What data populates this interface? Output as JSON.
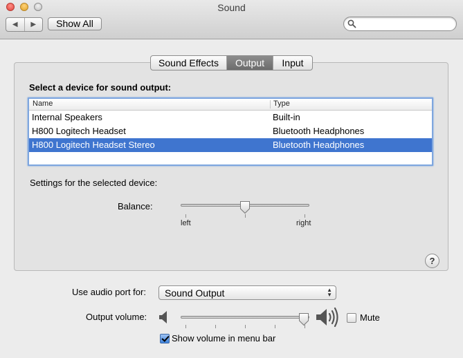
{
  "window": {
    "title": "Sound"
  },
  "toolbar": {
    "back_icon": "back-icon",
    "forward_icon": "forward-icon",
    "show_all_label": "Show All",
    "search_placeholder": ""
  },
  "tabs": [
    {
      "label": "Sound Effects",
      "selected": false
    },
    {
      "label": "Output",
      "selected": true
    },
    {
      "label": "Input",
      "selected": false
    }
  ],
  "output": {
    "section_title": "Select a device for sound output:",
    "columns": [
      "Name",
      "Type"
    ],
    "devices": [
      {
        "name": "Internal Speakers",
        "type": "Built-in",
        "selected": false
      },
      {
        "name": "H800 Logitech Headset",
        "type": "Bluetooth Headphones",
        "selected": false
      },
      {
        "name": "H800 Logitech Headset Stereo",
        "type": "Bluetooth Headphones",
        "selected": true
      }
    ],
    "settings_label": "Settings for the selected device:",
    "balance": {
      "label": "Balance:",
      "left_label": "left",
      "right_label": "right",
      "value": 0.5
    },
    "help_label": "?"
  },
  "bottom": {
    "audio_port_label": "Use audio port for:",
    "audio_port_value": "Sound Output",
    "output_volume_label": "Output volume:",
    "output_volume_value": 0.98,
    "mute_label": "Mute",
    "mute_checked": false,
    "show_in_menubar_label": "Show volume in menu bar",
    "show_in_menubar_checked": true
  },
  "colors": {
    "selection": "#3f75cf",
    "focus_ring": "#7ea6df",
    "tab_selected": "#7b7b7b"
  }
}
